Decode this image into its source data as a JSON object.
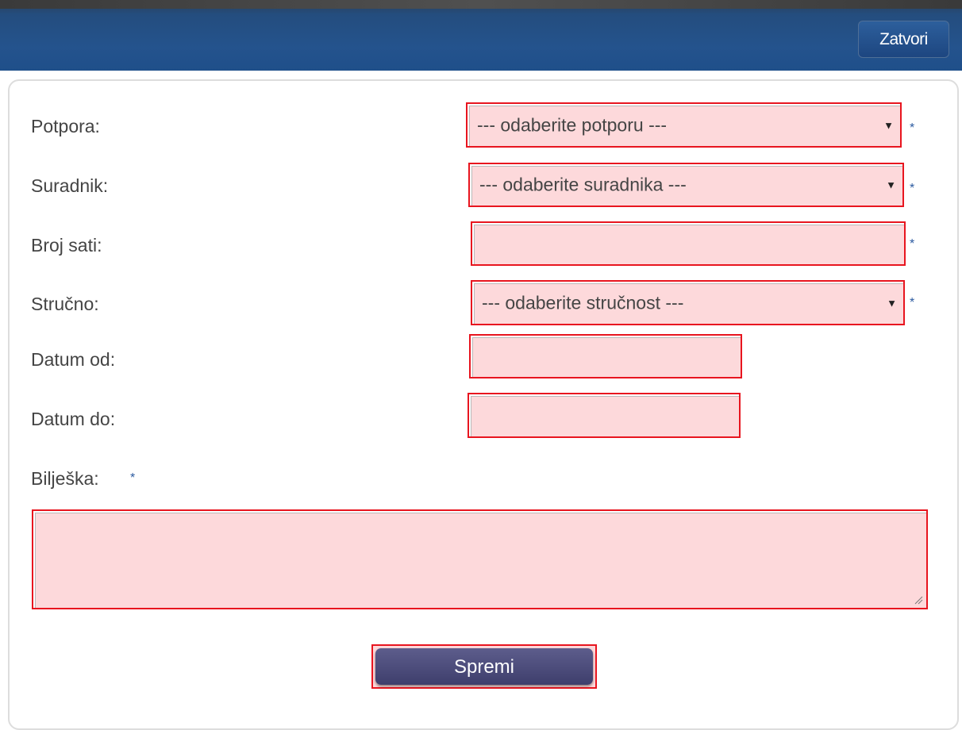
{
  "header": {
    "close_label": "Zatvori"
  },
  "form": {
    "potpora": {
      "label": "Potpora:",
      "value": "--- odaberite potporu ---",
      "required": "*"
    },
    "suradnik": {
      "label": "Suradnik:",
      "value": "--- odaberite suradnika ---",
      "required": "*"
    },
    "broj_sati": {
      "label": "Broj sati:",
      "value": "",
      "required": "*"
    },
    "strucno": {
      "label": "Stručno:",
      "value": "--- odaberite stručnost ---",
      "required": "*"
    },
    "datum_od": {
      "label": "Datum od:",
      "value": ""
    },
    "datum_do": {
      "label": "Datum do:",
      "value": ""
    },
    "biljeska": {
      "label": "Bilješka:",
      "value": "",
      "required": "*"
    }
  },
  "actions": {
    "save_label": "Spremi"
  },
  "colors": {
    "header_blue": "#24538d",
    "invalid_fill": "#fdd9db",
    "invalid_border": "#e8151f",
    "save_button": "#4a4a7a",
    "required_star": "#2b5aa0"
  }
}
